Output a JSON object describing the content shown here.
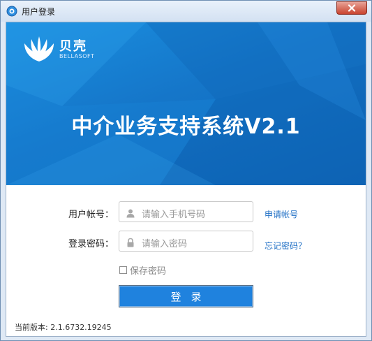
{
  "window": {
    "title": "用户登录",
    "close_icon": "close-icon"
  },
  "banner": {
    "brand_name": "贝壳",
    "brand_sub": "BELLASOFT",
    "system_title": "中介业务支持系统V2.1"
  },
  "form": {
    "account_label": "用户帐号：",
    "account_placeholder": "请输入手机号码",
    "password_label": "登录密码：",
    "password_placeholder": "请输入密码",
    "register_link": "申请帐号",
    "forgot_link": "忘记密码？",
    "remember_label": "保存密码",
    "remember_checked": false,
    "login_button": "登录"
  },
  "footer": {
    "version_text": "当前版本: 2.1.6732.19245"
  },
  "colors": {
    "banner_blue": "#1576c9",
    "button_blue": "#1f82de",
    "link_blue": "#1f6fc5",
    "close_red": "#c9442f"
  }
}
